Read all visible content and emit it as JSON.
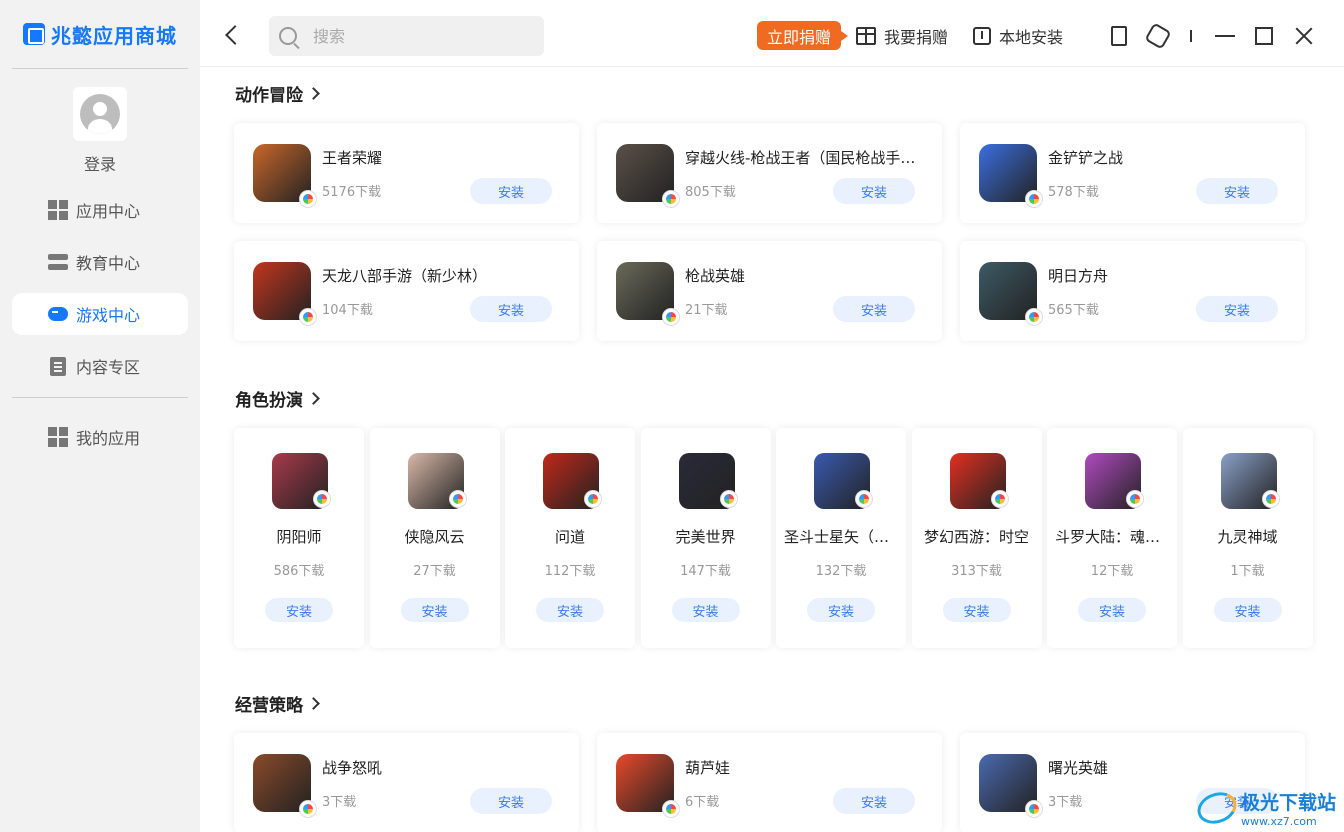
{
  "brand": {
    "name": "兆懿应用商城",
    "color": "#1677ff"
  },
  "user": {
    "login_label": "登录"
  },
  "sidebar": {
    "items": [
      {
        "label": "应用中心",
        "icon": "apps-grid-icon",
        "active": false
      },
      {
        "label": "教育中心",
        "icon": "education-stack-icon",
        "active": false
      },
      {
        "label": "游戏中心",
        "icon": "gamepad-icon",
        "active": true
      },
      {
        "label": "内容专区",
        "icon": "document-icon",
        "active": false
      }
    ],
    "my_apps_label": "我的应用"
  },
  "toolbar": {
    "search_placeholder": "搜索",
    "donate_now": "立即捐赠",
    "donate": "我要捐赠",
    "local_install": "本地安装"
  },
  "sections": [
    {
      "title": "动作冒险",
      "layout": "wide",
      "apps": [
        {
          "name": "王者荣耀",
          "downloads": "5176下载",
          "install": "安装",
          "icon_color": "#c9672a"
        },
        {
          "name": "穿越火线-枪战王者（国民枪战手游）",
          "downloads": "805下载",
          "install": "安装",
          "icon_color": "#5b5048"
        },
        {
          "name": "金铲铲之战",
          "downloads": "578下载",
          "install": "安装",
          "icon_color": "#3b6fe0"
        },
        {
          "name": "天龙八部手游（新少林）",
          "downloads": "104下载",
          "install": "安装",
          "icon_color": "#c2361e"
        },
        {
          "name": "枪战英雄",
          "downloads": "21下载",
          "install": "安装",
          "icon_color": "#6a6a5a"
        },
        {
          "name": "明日方舟",
          "downloads": "565下载",
          "install": "安装",
          "icon_color": "#3d5a66"
        }
      ]
    },
    {
      "title": "角色扮演",
      "layout": "tall",
      "apps": [
        {
          "name": "阴阳师",
          "downloads": "586下载",
          "install": "安装",
          "icon_color": "#a83a4a"
        },
        {
          "name": "侠隐风云",
          "downloads": "27下载",
          "install": "安装",
          "icon_color": "#d9b8a8"
        },
        {
          "name": "问道",
          "downloads": "112下载",
          "install": "安装",
          "icon_color": "#c0281a"
        },
        {
          "name": "完美世界",
          "downloads": "147下载",
          "install": "安装",
          "icon_color": "#2a2a3a"
        },
        {
          "name": "圣斗士星矢（正版授权）",
          "downloads": "132下载",
          "install": "安装",
          "icon_color": "#3a5ab0"
        },
        {
          "name": "梦幻西游：时空",
          "downloads": "313下载",
          "install": "安装",
          "icon_color": "#e23020"
        },
        {
          "name": "斗罗大陆：魂师对决",
          "downloads": "12下载",
          "install": "安装",
          "icon_color": "#b04ac0"
        },
        {
          "name": "九灵神域",
          "downloads": "1下载",
          "install": "安装",
          "icon_color": "#8aa0c8"
        }
      ]
    },
    {
      "title": "经营策略",
      "layout": "wide",
      "apps": [
        {
          "name": "战争怒吼",
          "downloads": "3下载",
          "install": "安装",
          "icon_color": "#8a4a2a"
        },
        {
          "name": "葫芦娃",
          "downloads": "6下载",
          "install": "安装",
          "icon_color": "#e84a2a"
        },
        {
          "name": "曙光英雄",
          "downloads": "3下载",
          "install": "安装",
          "icon_color": "#4a6ab0"
        }
      ]
    }
  ],
  "watermark": {
    "line1": "极光下载站",
    "line2": "www.xz7.com"
  }
}
